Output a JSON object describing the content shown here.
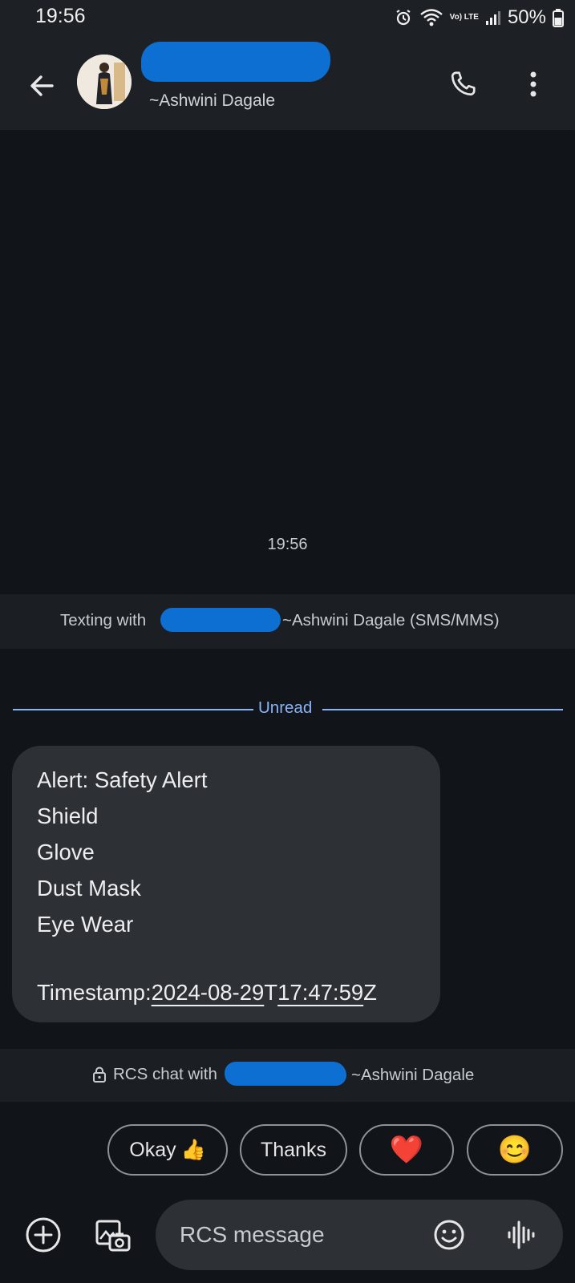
{
  "status_bar": {
    "time": "19:56",
    "network": "Vo) LTE",
    "battery": "50%",
    "icons": [
      "alarm-icon",
      "wifi-icon",
      "volte-icon",
      "signal-icon",
      "battery-icon"
    ]
  },
  "header": {
    "contact_subtitle": "~Ashwini Dagale",
    "icons": [
      "back-arrow-icon",
      "avatar",
      "phone-icon",
      "more-vert-icon"
    ]
  },
  "conversation": {
    "message_time": "19:56",
    "texting_with_prefix": "Texting with",
    "texting_with_suffix": "~Ashwini Dagale (SMS/MMS)",
    "unread_label": "Unread",
    "message": {
      "body": "Alert: Safety Alert\nShield\nGlove\nDust Mask\nEye Wear\n",
      "timestamp_label": "Timestamp: ",
      "timestamp_date": "2024-08-29",
      "timestamp_t": "T",
      "timestamp_time": "17:47:59",
      "timestamp_z": "Z"
    },
    "rcs_prefix": "RCS chat with",
    "rcs_suffix": "~Ashwini Dagale"
  },
  "suggestions": [
    {
      "label": "Okay",
      "emoji": "👍"
    },
    {
      "label": "Thanks",
      "emoji": ""
    },
    {
      "label": "",
      "emoji": "❤️"
    },
    {
      "label": "",
      "emoji": "😊"
    }
  ],
  "compose": {
    "placeholder": "RCS message",
    "icons": [
      "add-circle-icon",
      "gallery-camera-icon",
      "emoji-icon",
      "voice-waveform-icon"
    ]
  },
  "colors": {
    "background": "#111418",
    "bar": "#1d2024",
    "bubble": "#2d3034",
    "accent": "#8ab4f8",
    "redaction": "#0d6fd1"
  }
}
